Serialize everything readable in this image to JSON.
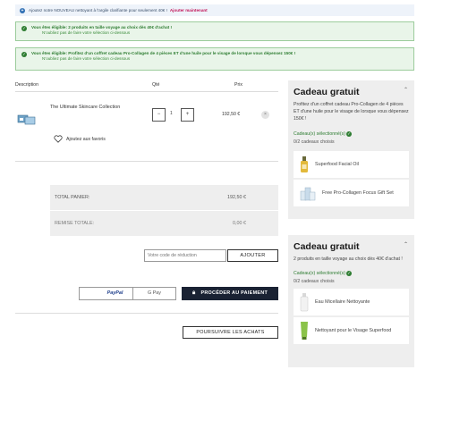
{
  "promo": {
    "text": "Ajoutez notre NOUVEAU nettoyant à l'argile clarifiante pour seulement 40€ !",
    "link": "Ajouter maintenant"
  },
  "notices": [
    {
      "title": "Vous êtes éligible: 2 produits en taille voyage au choix dès 40€ d'achat !",
      "sub": "N'oubliez pas de faire votre sélection ci-dessous"
    },
    {
      "title": "Vous êtes éligible: Profitez d'un coffret cadeau Pro-Collagen de 4 pièces ET d'une huile pour le visage de lorsque vous dépensez 150€ !",
      "sub": "N'oubliez pas de faire votre sélection ci-dessous"
    }
  ],
  "table": {
    "headers": {
      "description": "Description",
      "qty": "Qté",
      "price": "Prix"
    }
  },
  "cart_item": {
    "name": "The Ultimate Skincare Collection",
    "qty_minus": "−",
    "qty": "1",
    "qty_plus": "+",
    "price": "192,50 €",
    "remove": "×",
    "favorite": "Ajoutez aux favoris"
  },
  "totals": {
    "total_label": "TOTAL PANIER:",
    "total_value": "192,50 €",
    "discount_label": "REMISE TOTALE:",
    "discount_value": "0,00 €"
  },
  "promo_code": {
    "placeholder": "Votre code de réduction",
    "button": "AJOUTER"
  },
  "payment": {
    "paypal": "PayPal",
    "gpay": "G Pay",
    "checkout": "PROCÉDER AU PAIEMENT",
    "continue": "POURSUIVRE LES ACHATS"
  },
  "gifts": [
    {
      "title": "Cadeau gratuit",
      "description": "Profitez d'un coffret cadeau Pro-Collagen de 4 pièces ET d'une huile pour le visage de lorsque vous dépensez 150€ !",
      "selected_label": "Cadeau(x) sélectionné(s)",
      "count": "0/2 cadeaux choisis",
      "items": [
        "Superfood Facial Oil",
        "Free Pro-Collagen Focus Gift Set"
      ]
    },
    {
      "title": "Cadeau gratuit",
      "description": "2 produits en taille voyage au choix dès 40€ d'achat !",
      "selected_label": "Cadeau(x) sélectionné(s)",
      "count": "0/2 cadeaux choisis",
      "items": [
        "Eau Micellaire Nettoyante",
        "Nettoyant pour le Visage Superfood"
      ]
    }
  ],
  "colors": {
    "accent_green": "#2e7d32",
    "link_pink": "#c2185b",
    "checkout_dark": "#1a2233"
  },
  "icons": [
    "plus-circle-icon",
    "check-circle-icon",
    "heart-icon",
    "lock-icon",
    "chevron-up-icon",
    "close-icon"
  ]
}
